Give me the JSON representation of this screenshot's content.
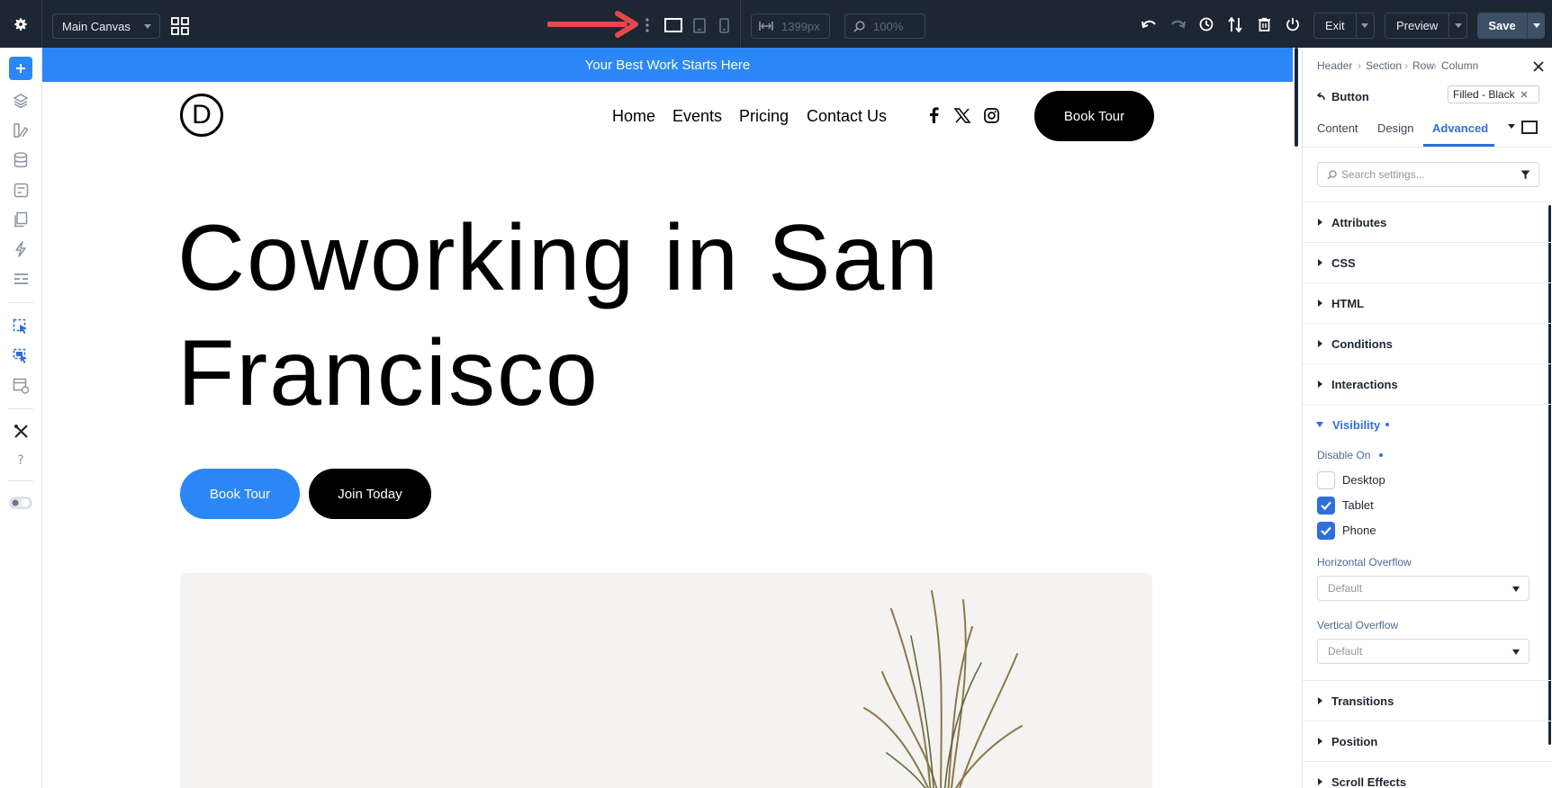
{
  "toolbar": {
    "canvas_select": "Main Canvas",
    "width_value": "1399px",
    "zoom_value": "100%",
    "exit_label": "Exit",
    "preview_label": "Preview",
    "save_label": "Save"
  },
  "canvas": {
    "announcement": "Your Best Work Starts Here",
    "logo_letter": "D",
    "nav": [
      "Home",
      "Events",
      "Pricing",
      "Contact Us"
    ],
    "social_icons": [
      "facebook-icon",
      "x-icon",
      "instagram-icon"
    ],
    "header_button": "Book Tour",
    "hero_line1": "Coworking in San",
    "hero_line2": "Francisco",
    "cta_primary": "Book Tour",
    "cta_secondary": "Join Today"
  },
  "panel": {
    "breadcrumb": [
      "Header",
      "Section",
      "Row",
      "Column"
    ],
    "element_name": "Button",
    "preset_badge": "Filled - Black",
    "tabs": [
      "Content",
      "Design",
      "Advanced"
    ],
    "active_tab": "Advanced",
    "search_placeholder": "Search settings...",
    "sections_top": [
      "Attributes",
      "CSS",
      "HTML",
      "Conditions",
      "Interactions"
    ],
    "visibility": {
      "title": "Visibility",
      "disable_on_label": "Disable On",
      "options": [
        {
          "label": "Desktop",
          "checked": false
        },
        {
          "label": "Tablet",
          "checked": true
        },
        {
          "label": "Phone",
          "checked": true
        }
      ],
      "horizontal_overflow_label": "Horizontal Overflow",
      "horizontal_overflow_value": "Default",
      "vertical_overflow_label": "Vertical Overflow",
      "vertical_overflow_value": "Default"
    },
    "sections_bottom": [
      "Transitions",
      "Position",
      "Scroll Effects"
    ]
  },
  "colors": {
    "toolbar_bg": "#1d2633",
    "accent_blue": "#2b87f5",
    "panel_accent": "#2f6fdc",
    "annotation_red": "#e5484d"
  }
}
